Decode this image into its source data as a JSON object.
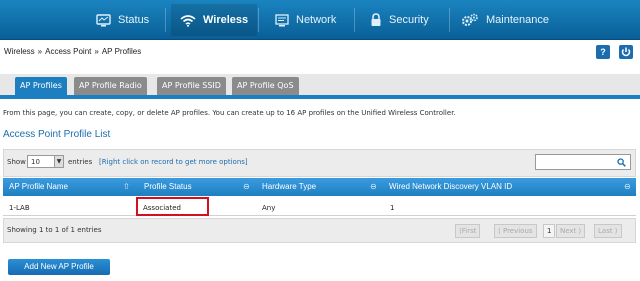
{
  "nav": {
    "items": [
      {
        "label": "Status",
        "icon": "status-monitor-icon"
      },
      {
        "label": "Wireless",
        "icon": "wifi-icon"
      },
      {
        "label": "Network",
        "icon": "network-monitor-icon"
      },
      {
        "label": "Security",
        "icon": "lock-icon"
      },
      {
        "label": "Maintenance",
        "icon": "gears-icon"
      }
    ],
    "active": "Wireless"
  },
  "breadcrumb": [
    "Wireless",
    "Access Point",
    "AP Profiles"
  ],
  "header_buttons": {
    "help": "?",
    "logout": "logout-icon"
  },
  "tabs": [
    {
      "label": "AP Profiles"
    },
    {
      "label": "AP Profile Radio"
    },
    {
      "label": "AP Profile SSID"
    },
    {
      "label": "AP Profile QoS"
    }
  ],
  "description": "From this page, you can create, copy, or delete AP profiles. You can create up to 16 AP profiles on the Unified Wireless Controller.",
  "section_title": "Access Point Profile List",
  "controls": {
    "show_label": "Show",
    "page_size": "10",
    "entries_label": "entries",
    "hint": "[Right click on record to get more options]",
    "search_value": ""
  },
  "table": {
    "columns": [
      "AP Profile Name",
      "Profile Status",
      "Hardware Type",
      "Wired Network Discovery VLAN ID"
    ],
    "rows": [
      [
        "1-LAB",
        "Associated",
        "Any",
        "1"
      ]
    ]
  },
  "footer": {
    "info": "Showing 1 to 1 of 1 entries",
    "pagination": {
      "first": "First",
      "previous": "Previous",
      "page": "1",
      "next": "Next",
      "last": "Last"
    }
  },
  "add_button": "Add New AP Profile",
  "colors": {
    "accent": "#1e7fc0",
    "highlight": "#d50f1d"
  }
}
